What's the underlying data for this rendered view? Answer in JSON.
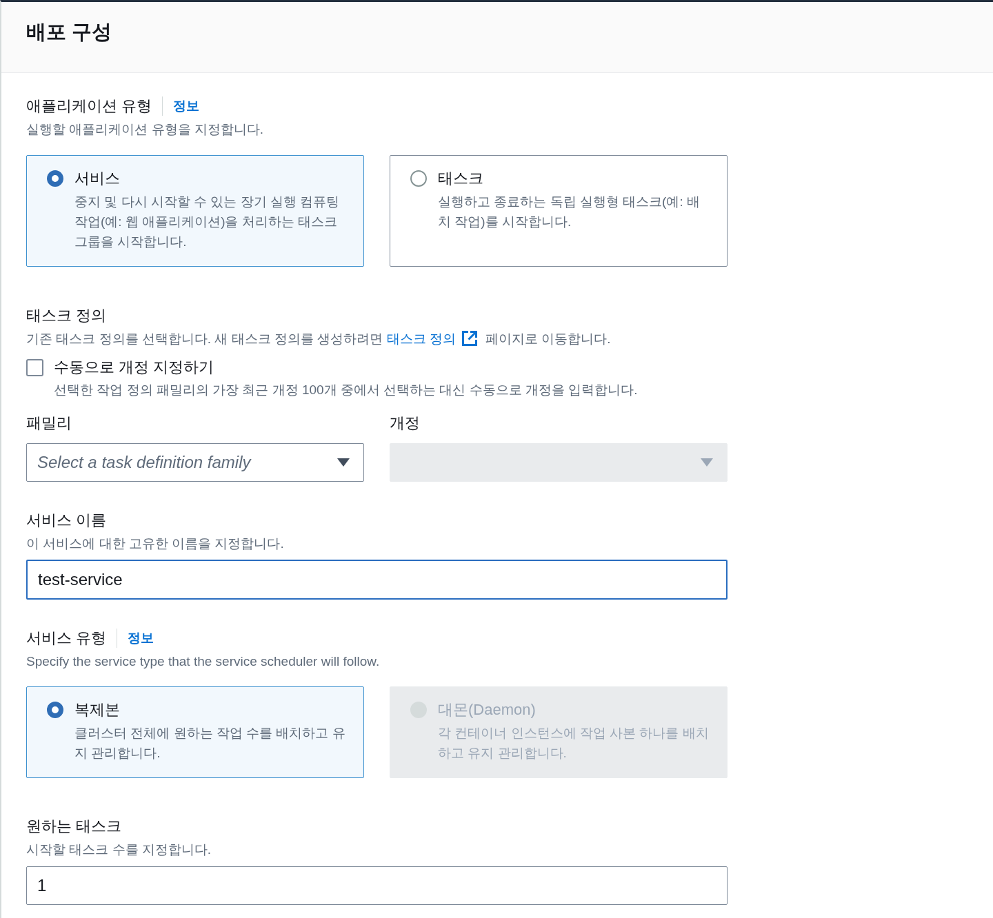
{
  "header": {
    "title": "배포 구성"
  },
  "application_type": {
    "label": "애플리케이션 유형",
    "info_link": "정보",
    "description": "실행할 애플리케이션 유형을 지정합니다.",
    "options": [
      {
        "title": "서비스",
        "description": "중지 및 다시 시작할 수 있는 장기 실행 컴퓨팅 작업(예: 웹 애플리케이션)을 처리하는 태스크 그룹을 시작합니다.",
        "selected": true
      },
      {
        "title": "태스크",
        "description": "실행하고 종료하는 독립 실행형 태스크(예: 배치 작업)를 시작합니다.",
        "selected": false
      }
    ]
  },
  "task_definition": {
    "label": "태스크 정의",
    "description": [
      {
        "kind": "text",
        "text": "기존 태스크 정의를 선택합니다. 새 태스크 정의를 생성하려면 "
      },
      {
        "kind": "link",
        "text": "태스크 정의",
        "external": true
      },
      {
        "kind": "text",
        "text": " 페이지로 이동합니다."
      }
    ],
    "manual_revision": {
      "label": "수동으로 개정 지정하기",
      "checked": false,
      "description": "선택한 작업 정의 패밀리의 가장 최근 개정 100개 중에서 선택하는 대신 수동으로 개정을 입력합니다."
    },
    "family": {
      "label": "패밀리",
      "placeholder": "Select a task definition family",
      "disabled": false
    },
    "revision": {
      "label": "개정",
      "disabled": true
    }
  },
  "service_name": {
    "label": "서비스 이름",
    "description": "이 서비스에 대한 고유한 이름을 지정합니다.",
    "value": "test-service",
    "focused": true
  },
  "service_type": {
    "label": "서비스 유형",
    "info_link": "정보",
    "description": "Specify the service type that the service scheduler will follow.",
    "options": [
      {
        "title": "복제본",
        "description": "클러스터 전체에 원하는 작업 수를 배치하고 유지 관리합니다.",
        "selected": true,
        "disabled": false
      },
      {
        "title": "대몬(Daemon)",
        "description": "각 컨테이너 인스턴스에 작업 사본 하나를 배치하고 유지 관리합니다.",
        "selected": false,
        "disabled": true
      }
    ]
  },
  "desired_tasks": {
    "label": "원하는 태스크",
    "description": "시작할 태스크 수를 지정합니다.",
    "value": "1",
    "focused": false
  }
}
